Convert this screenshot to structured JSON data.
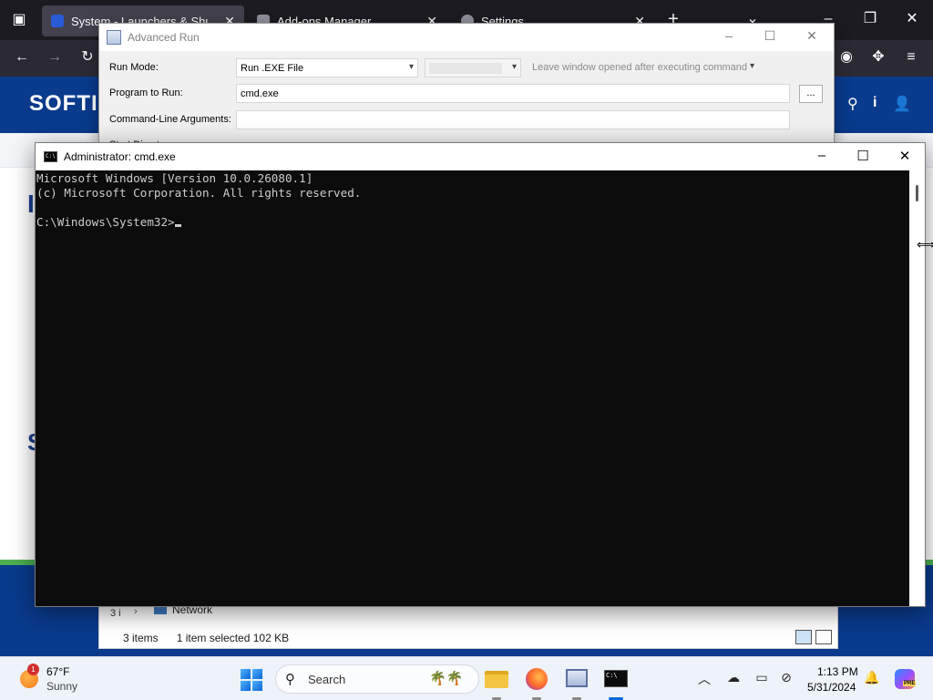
{
  "browser": {
    "tabs": [
      {
        "label": "System - Launchers & Shutdown",
        "active": true
      },
      {
        "label": "Add-ons Manager",
        "active": false
      },
      {
        "label": "Settings",
        "active": false
      }
    ],
    "new_tab": "+",
    "tab_close": "✕",
    "list_all_tabs": "⌄"
  },
  "site": {
    "logo": "SOFTI",
    "fragment_a": "I",
    "fragment_b": "S"
  },
  "advanced_run": {
    "title": "Advanced Run",
    "run_mode_label": "Run Mode:",
    "run_mode_value": "Run .EXE File",
    "keep_window_option": "Leave window opened after executing command",
    "program_label": "Program to Run:",
    "program_value": "cmd.exe",
    "browse_label": "...",
    "args_label": "Command-Line Arguments:",
    "args_value": "",
    "start_dir_label": "Start Directory:"
  },
  "cmd": {
    "title": "Administrator: cmd.exe",
    "line1": "Microsoft Windows [Version 10.0.26080.1]",
    "line2": "(c) Microsoft Corporation. All rights reserved.",
    "line3": "",
    "prompt": "C:\\Windows\\System32>"
  },
  "explorer": {
    "nav_item": "Network",
    "item_count": "3 items",
    "selection": "1 item selected  102 KB",
    "left_fragment": "3 i"
  },
  "taskbar": {
    "weather_temp": "67°F",
    "weather_condition": "Sunny",
    "weather_badge": "1",
    "search_placeholder": "Search",
    "time": "1:13 PM",
    "date": "5/31/2024",
    "copilot_badge": "PRE"
  },
  "colors": {
    "site_blue": "#0a3a8c",
    "site_green": "#4caf50",
    "terminal_bg": "#0c0c0c",
    "terminal_fg": "#cccccc",
    "browser_dark": "#1c1b22"
  }
}
